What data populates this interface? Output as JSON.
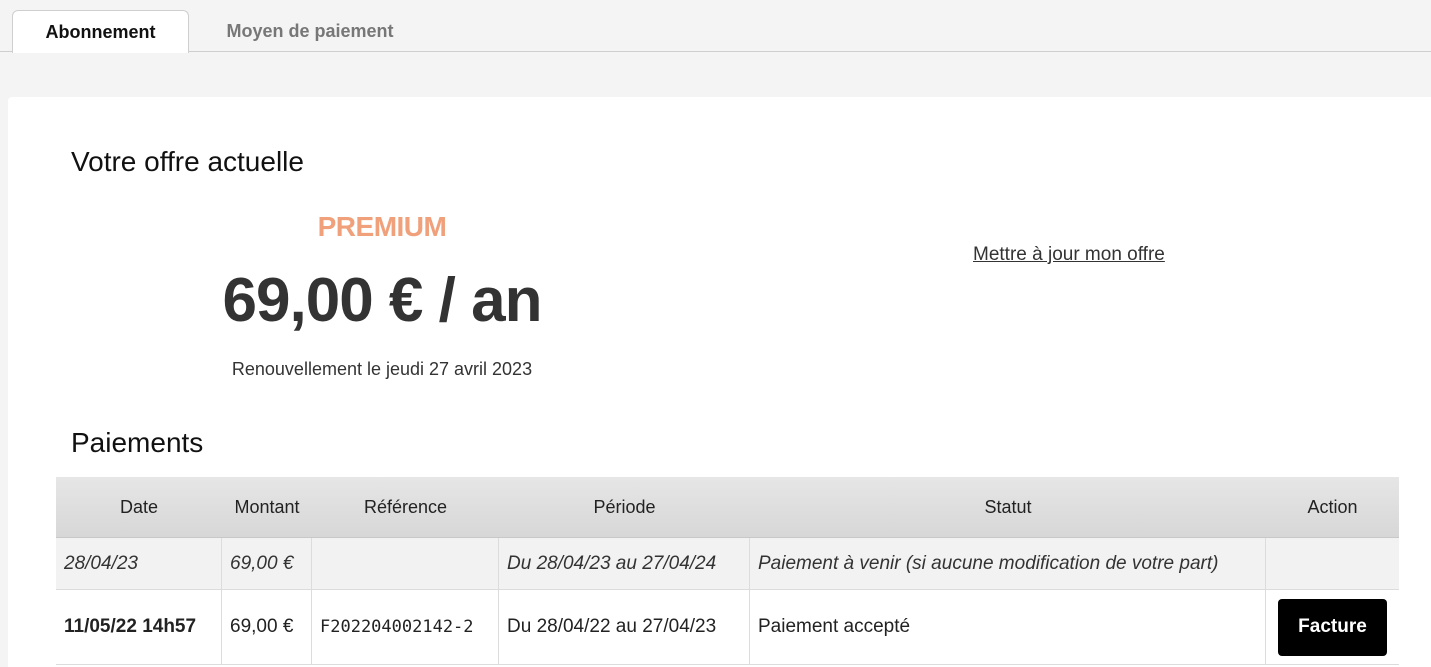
{
  "tabs": [
    {
      "label": "Abonnement",
      "active": true
    },
    {
      "label": "Moyen de paiement",
      "active": false
    }
  ],
  "offer": {
    "title": "Votre offre actuelle",
    "plan_name": "PREMIUM",
    "price": "69,00 € / an",
    "renewal": "Renouvellement le jeudi 27 avril 2023",
    "update_link": "Mettre à jour mon offre"
  },
  "payments": {
    "title": "Paiements",
    "columns": [
      "Date",
      "Montant",
      "Référence",
      "Période",
      "Statut",
      "Action"
    ],
    "rows": [
      {
        "date": "28/04/23",
        "amount": "69,00 €",
        "reference": "",
        "period": "Du 28/04/23 au 27/04/24",
        "status": "Paiement à venir (si aucune modification de votre part)",
        "action": ""
      },
      {
        "date": "11/05/22 14h57",
        "amount": "69,00 €",
        "reference": "F202204002142-2",
        "period": "Du 28/04/22 au 27/04/23",
        "status": "Paiement accepté",
        "action": "Facture"
      }
    ]
  },
  "colors": {
    "accent": "#f0a07a",
    "button_bg": "#000000"
  }
}
